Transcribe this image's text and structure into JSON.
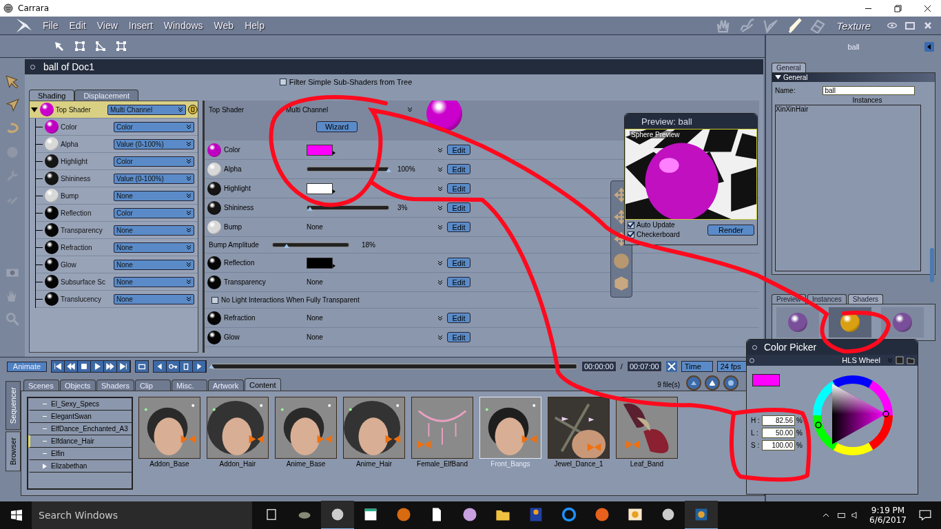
{
  "window": {
    "title": "Carrara"
  },
  "menu": [
    "File",
    "Edit",
    "View",
    "Insert",
    "Windows",
    "Web",
    "Help"
  ],
  "room": {
    "title": "Texture"
  },
  "document": {
    "title": "ball of Doc1",
    "filter": {
      "label": "Filter Simple Sub-Shaders from Tree",
      "checked": false
    }
  },
  "shader_tabs": [
    {
      "label": "Shading",
      "selected": true
    },
    {
      "label": "Displacement",
      "selected": false
    }
  ],
  "tree": {
    "root": {
      "label": "Top Shader",
      "type": "Multi Channel",
      "color": "#cc00cc",
      "expanded": true,
      "selected": true
    },
    "children": [
      {
        "label": "Color",
        "type": "Color",
        "color": "#c000c0"
      },
      {
        "label": "Alpha",
        "type": "Value (0-100%)",
        "color": "#d8d8d8"
      },
      {
        "label": "Highlight",
        "type": "Color",
        "color": "#151515"
      },
      {
        "label": "Shininess",
        "type": "Value (0-100%)",
        "color": "#151515"
      },
      {
        "label": "Bump",
        "type": "None",
        "color": "#d8d8d8"
      },
      {
        "label": "Reflection",
        "type": "Color",
        "color": "#050505"
      },
      {
        "label": "Transparency",
        "type": "None",
        "color": "#050505"
      },
      {
        "label": "Refraction",
        "type": "None",
        "color": "#050505"
      },
      {
        "label": "Glow",
        "type": "None",
        "color": "#050505"
      },
      {
        "label": "Subsurface Sc",
        "type": "None",
        "color": "#050505"
      },
      {
        "label": "Translucency",
        "type": "None",
        "color": "#050505"
      }
    ]
  },
  "params": {
    "header": {
      "label": "Top Shader",
      "value": "Multi Channel",
      "button": "Wizard",
      "color": "#cc00cc"
    },
    "rows": [
      {
        "kind": "color",
        "label": "Color",
        "color": "#c000c0",
        "swatch": {
          "color": "#ff00ff"
        },
        "button": "Edit"
      },
      {
        "kind": "slider",
        "label": "Alpha",
        "color": "#d8d8d8",
        "level": 1,
        "reading": "100%",
        "button": "Edit"
      },
      {
        "kind": "color",
        "label": "Highlight",
        "color": "#151515",
        "swatch": {
          "color": "#ffffff"
        },
        "button": "Edit"
      },
      {
        "kind": "slider",
        "label": "Shininess",
        "color": "#151515",
        "level": 0.03,
        "reading": "3%",
        "button": "Edit"
      },
      {
        "kind": "text",
        "label": "Bump",
        "color": "#d8d8d8",
        "value": "None",
        "button": "Edit"
      },
      {
        "kind": "amount",
        "label": "Bump Amplitude",
        "level": 0.18,
        "reading": "18%"
      },
      {
        "kind": "color",
        "label": "Reflection",
        "color": "#050505",
        "swatch": {
          "color": "#000000"
        },
        "button": "Edit"
      },
      {
        "kind": "text",
        "label": "Transparency",
        "color": "#050505",
        "value": "None",
        "button": "Edit"
      },
      {
        "kind": "checkbox",
        "label": "No Light Interactions When Fully Transparent",
        "checked": false
      },
      {
        "kind": "text",
        "label": "Refraction",
        "color": "#050505",
        "value": "None",
        "button": "Edit"
      },
      {
        "kind": "text",
        "label": "Glow",
        "color": "#050505",
        "value": "None",
        "button": "Edit"
      }
    ]
  },
  "preview": {
    "title": "Preview: ball",
    "overlay": "Sphere Preview",
    "options": [
      {
        "label": "Auto Update",
        "checked": true
      },
      {
        "label": "Checkerboard",
        "checked": true
      }
    ],
    "button": "Render"
  },
  "inspector": {
    "title": "ball",
    "tabs": [
      {
        "label": "General",
        "selected": true
      }
    ],
    "section": "General",
    "name_label": "Name:",
    "name_value": "ball",
    "instances_label": "Instances",
    "instances": [
      "XinXinHair"
    ]
  },
  "shader_browser": {
    "tabs": [
      {
        "label": "Preview",
        "selected": false
      },
      {
        "label": "Instances",
        "selected": false
      },
      {
        "label": "Shaders",
        "selected": true
      }
    ],
    "shaders": [
      {
        "color": "#7a4f9a",
        "selected": false
      },
      {
        "color": "#d9a012",
        "selected": true
      },
      {
        "color": "#7a4f9a",
        "selected": false
      }
    ]
  },
  "animation": {
    "button": "Animate",
    "time": "00:00:00",
    "separator": "/",
    "end": "00:07:00",
    "level": 0,
    "mode": "Time",
    "fps": "24 fps"
  },
  "browser": {
    "side_tabs": [
      {
        "label": "Sequencer",
        "selected": false
      },
      {
        "label": "Browser",
        "selected": true
      }
    ],
    "tabs": [
      {
        "label": "Scenes",
        "selected": false
      },
      {
        "label": "Objects",
        "selected": false
      },
      {
        "label": "Shaders",
        "selected": false
      },
      {
        "label": "Clip",
        "selected": false
      },
      {
        "label": "Misc.",
        "selected": false
      },
      {
        "label": "Artwork",
        "selected": false
      },
      {
        "label": "Content",
        "selected": true
      }
    ],
    "count": "9 file(s)",
    "folders": [
      {
        "label": "El_Sexy_Specs",
        "selected": false,
        "expandable": false
      },
      {
        "label": "ElegantSwan",
        "selected": false,
        "expandable": false
      },
      {
        "label": "ElfDance_Enchanted_A3",
        "selected": false,
        "expandable": false
      },
      {
        "label": "Elfdance_Hair",
        "selected": true,
        "expandable": false
      },
      {
        "label": "Elfin",
        "selected": false,
        "expandable": false
      },
      {
        "label": "Elizabethan",
        "selected": false,
        "expandable": true
      }
    ],
    "items": [
      {
        "label": "Addon_Base",
        "selected": false
      },
      {
        "label": "Addon_Hair",
        "selected": false
      },
      {
        "label": "Anime_Base",
        "selected": false
      },
      {
        "label": "Anime_Hair",
        "selected": false
      },
      {
        "label": "Female_ElfBand",
        "selected": false
      },
      {
        "label": "Front_Bangs",
        "selected": true
      },
      {
        "label": "Jewel_Dance_1",
        "selected": false
      },
      {
        "label": "Leaf_Band",
        "selected": false
      }
    ]
  },
  "color_picker": {
    "title": "Color Picker",
    "mode": "HLS Wheel",
    "color": "#ff00ff",
    "fields": [
      {
        "label": "H :",
        "value": "82.56",
        "unit": "%"
      },
      {
        "label": "L :",
        "value": "50.00",
        "unit": "%"
      },
      {
        "label": "S :",
        "value": "100.00",
        "unit": "%"
      }
    ]
  },
  "taskbar": {
    "search": "Search Windows",
    "time": "9:19 PM",
    "date": "6/6/2017"
  }
}
